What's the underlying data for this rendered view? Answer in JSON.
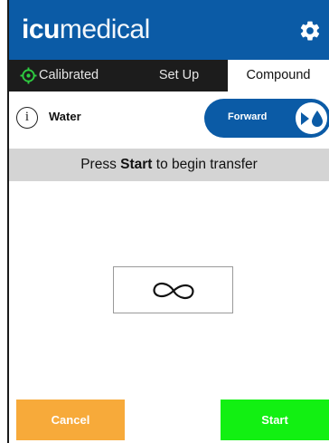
{
  "header": {
    "logo_bold": "icu",
    "logo_light": "medical",
    "settings_icon": "gear-icon",
    "brand_color": "#0b5ba6"
  },
  "tabs": [
    {
      "label": "Calibrated",
      "icon": "target-icon",
      "icon_color": "#2ecc40"
    },
    {
      "label": "Set Up"
    },
    {
      "label": "Compound",
      "active": true
    }
  ],
  "fluid": {
    "info_icon": "info-icon",
    "name": "Water"
  },
  "direction": {
    "label": "Forward",
    "icon": "drop-flow-icon"
  },
  "prompt": {
    "prefix": "Press ",
    "bold": "Start",
    "suffix": " to begin transfer"
  },
  "volume": {
    "icon": "infinity-icon"
  },
  "actions": {
    "cancel_label": "Cancel",
    "start_label": "Start",
    "cancel_color": "#f7aa3a",
    "start_color": "#12f012"
  }
}
